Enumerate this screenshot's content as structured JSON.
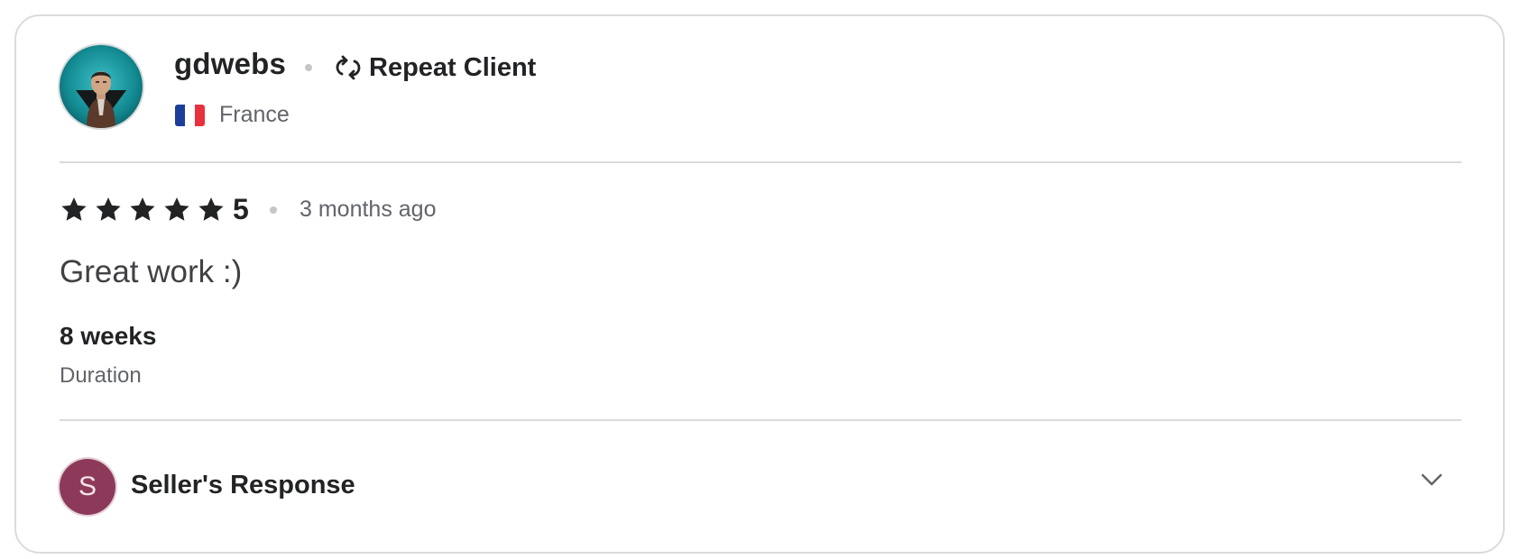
{
  "reviewer": {
    "username": "gdwebs",
    "badge_label": "Repeat Client",
    "country": "France",
    "avatar": {
      "icon": "person-portrait-avatar"
    },
    "flag": {
      "icon": "france-flag-icon",
      "colors": [
        "#1d3d9b",
        "#ffffff",
        "#e8313d"
      ]
    }
  },
  "review": {
    "rating_value": "5",
    "stars_filled": 5,
    "stars_total": 5,
    "time_ago": "3 months ago",
    "text": "Great work :)"
  },
  "duration": {
    "value": "8 weeks",
    "label": "Duration"
  },
  "seller_response": {
    "avatar_initial": "S",
    "avatar_color": "#8d3a5a",
    "label": "Seller's Response",
    "expand_icon": "chevron-down-icon"
  },
  "colors": {
    "text_primary": "#222325",
    "text_secondary": "#62646a",
    "border": "#dadbdd",
    "star": "#222325"
  }
}
